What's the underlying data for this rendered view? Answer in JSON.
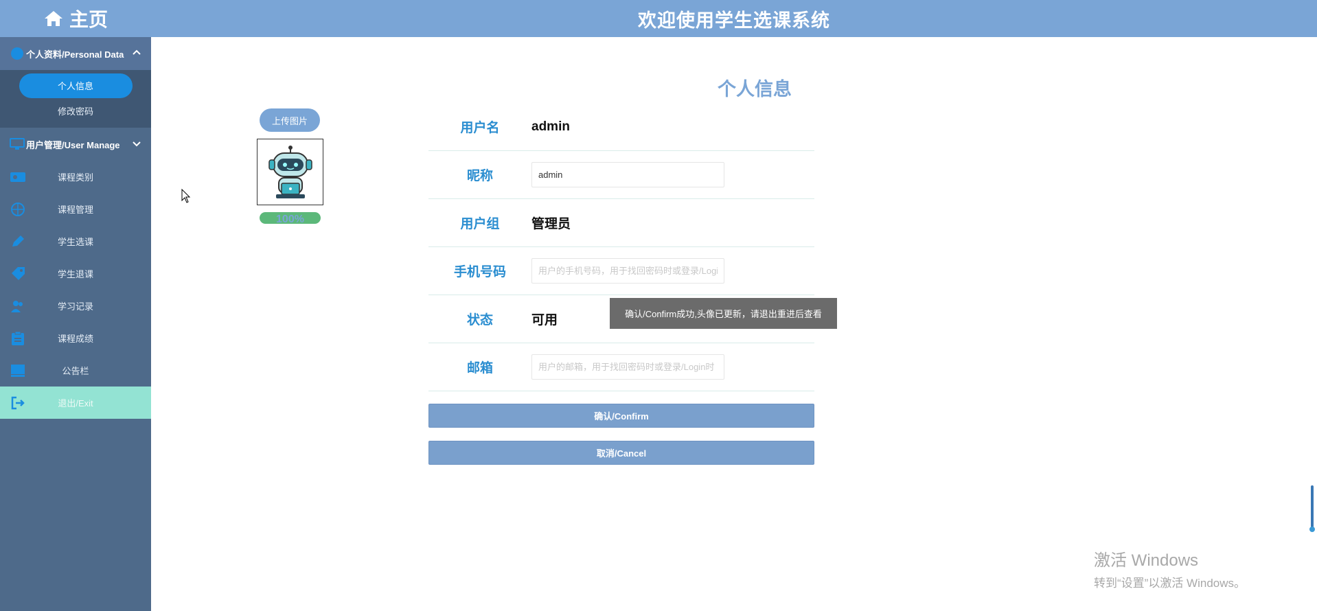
{
  "brand": {
    "label": "主页"
  },
  "header": {
    "title": "欢迎使用学生选课系统"
  },
  "sidebar": {
    "groups": [
      {
        "label": "个人资料/Personal Data",
        "expanded": true,
        "items": [
          {
            "label": "个人信息",
            "active": true
          },
          {
            "label": "修改密码"
          }
        ]
      },
      {
        "label": "用户管理/User Manage",
        "expanded": false
      }
    ],
    "nav": [
      {
        "label": "课程类别"
      },
      {
        "label": "课程管理"
      },
      {
        "label": "学生选课"
      },
      {
        "label": "学生退课"
      },
      {
        "label": "学习记录"
      },
      {
        "label": "课程成绩"
      },
      {
        "label": "公告栏"
      }
    ],
    "exit": {
      "label": "退出/Exit"
    }
  },
  "main": {
    "title": "个人信息",
    "upload_label": "上传图片",
    "progress": {
      "text": "100%",
      "value": 1.0
    },
    "fields": {
      "username": {
        "label": "用户名",
        "value": "admin"
      },
      "nickname": {
        "label": "昵称",
        "value": "admin"
      },
      "group": {
        "label": "用户组",
        "value": "管理员"
      },
      "phone": {
        "label": "手机号码",
        "placeholder": "用户的手机号码，用于找回密码时或登录/Login"
      },
      "status": {
        "label": "状态",
        "value": "可用"
      },
      "email": {
        "label": "邮箱",
        "placeholder": "用户的邮箱，用于找回密码时或登录/Login时"
      }
    },
    "confirm_label": "确认/Confirm",
    "cancel_label": "取消/Cancel",
    "toast": "确认/Confirm成功,头像已更新，请退出重进后查看"
  },
  "watermark": {
    "line1": "激活 Windows",
    "line2": "转到“设置”以激活 Windows。"
  },
  "colors": {
    "sidebar": "#4e6a8a",
    "header": "#7aa5d6",
    "accent": "#1a8de0",
    "label": "#2a8dd0",
    "exit": "#93e3d3"
  }
}
